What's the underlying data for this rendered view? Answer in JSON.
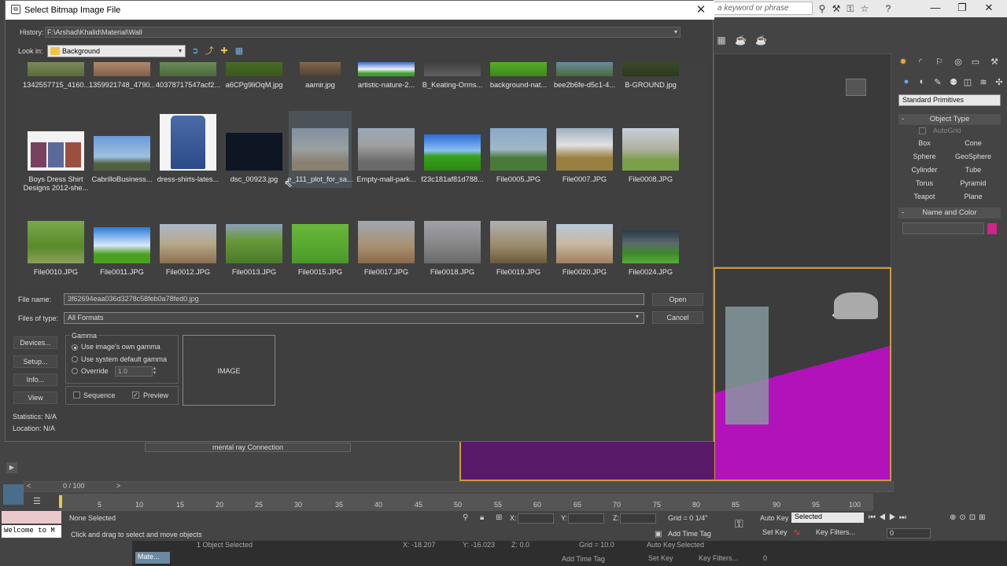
{
  "dialog": {
    "title": "Select Bitmap Image File",
    "history_label": "History:",
    "history_value": "F:\\Arshad\\Khalid\\Material\\Wall",
    "lookin_label": "Look in:",
    "lookin_value": "Background",
    "file_name_label": "File name:",
    "file_name_value": "3f62694eaa036d3278c58feb0a78fed0.jpg",
    "files_of_type_label": "Files of type:",
    "files_of_type_value": "All Formats",
    "open_label": "Open",
    "cancel_label": "Cancel",
    "devices_label": "Devices...",
    "setup_label": "Setup...",
    "info_label": "Info...",
    "view_label": "View",
    "gamma_title": "Gamma",
    "gamma_opt1": "Use image's own gamma",
    "gamma_opt2": "Use system default gamma",
    "gamma_opt3": "Override",
    "override_value": "1.0",
    "sequence_label": "Sequence",
    "preview_label": "Preview",
    "preview_placeholder": "IMAGE",
    "statistics": "Statistics:  N/A",
    "location": "Location:  N/A",
    "files_row1": [
      "1342557715_4160...",
      "1359921748_4790...",
      "40378717547acf2...",
      "a6CPg9liOqM.jpg",
      "aamir.jpg",
      "artistic-nature-2...",
      "B_Keating-Orms...",
      "background-nat...",
      "bee2b6fe-d5c1-4...",
      "B-GROUND.jpg"
    ],
    "files_row2": [
      "Boys Dress Shirt Designs 2012-she...",
      "CabrilloBusiness...",
      "dress-shirts-lates...",
      "dsc_00923.jpg",
      "e_111_plot_for_sa...",
      "Empty-mall-park...",
      "f23c181af81d788...",
      "File0005.JPG",
      "File0007.JPG",
      "File0008.JPG"
    ],
    "files_row3": [
      "File0010.JPG",
      "File0011.JPG",
      "File0012.JPG",
      "File0013.JPG",
      "File0015.JPG",
      "File0017.JPG",
      "File0018.JPG",
      "File0019.JPG",
      "File0020.JPG",
      "File0024.JPG"
    ]
  },
  "max": {
    "search_placeholder": "a keyword or phrase",
    "std_primitives": "Standard Primitives",
    "object_type": "Object Type",
    "autogrid": "AutoGrid",
    "primitives": [
      "Box",
      "Cone",
      "Sphere",
      "GeoSphere",
      "Cylinder",
      "Tube",
      "Torus",
      "Pyramid",
      "Teapot",
      "Plane"
    ],
    "name_and_color": "Name and Color",
    "mental_ray": "mental ray Connection",
    "time_label": "0 / 100",
    "ticks": [
      "5",
      "10",
      "15",
      "20",
      "25",
      "30",
      "35",
      "40",
      "45",
      "50",
      "55",
      "60",
      "65",
      "70",
      "75",
      "80",
      "85",
      "90",
      "95",
      "100"
    ],
    "none_selected": "None Selected",
    "click_drag": "Click and drag to select and move objects",
    "welcome": "Welcome to M",
    "x_label": "X:",
    "y_label": "Y:",
    "z_label": "Z:",
    "grid": "Grid = 0 1/4\"",
    "add_time_tag": "Add Time Tag",
    "auto_key": "Auto Key",
    "set_key": "Set Key",
    "selected": "Selected",
    "key_filters": "Key Filters...",
    "frame": "0",
    "ghost_obj": "1 Object Selected",
    "ghost_x": "X: -18.207",
    "ghost_y": "Y: -16.023",
    "ghost_z": "Z: 0.0",
    "ghost_grid": "Grid = 10.0",
    "ghost_autokey": "Auto Key",
    "ghost_selected": "Selected",
    "ghost_setkey": "Set Key",
    "ghost_keyfilters": "Key Filters...",
    "ghost_addtag": "Add Time Tag",
    "ghost_frame": "0",
    "taskbar_max": "Mate..."
  }
}
